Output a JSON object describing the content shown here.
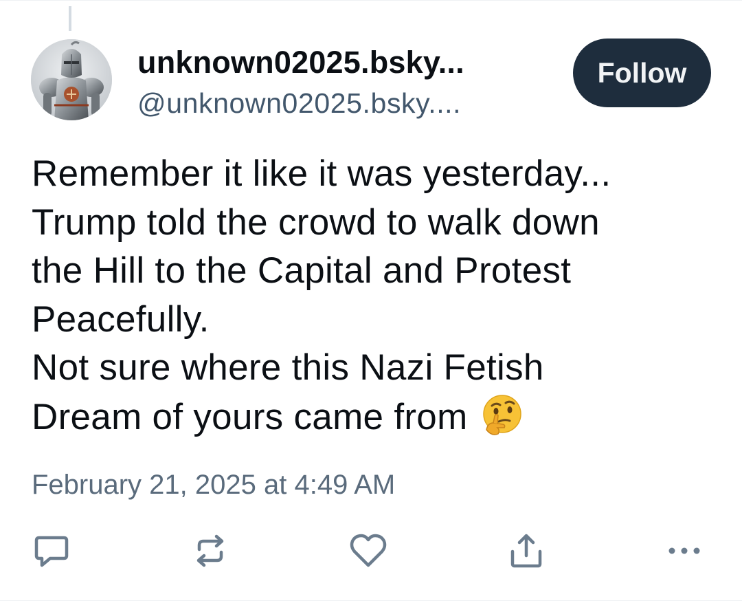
{
  "post": {
    "author": {
      "display_name": "unknown02025.bsky...",
      "handle": "@unknown02025.bsky....",
      "avatar": "knight-armor-avatar"
    },
    "follow_label": "Follow",
    "text_lines": [
      "Remember it like it was yesterday...",
      "Trump told the crowd to walk down",
      "the Hill to the Capital and Protest",
      "Peacefully.",
      "Not sure where this Nazi Fetish",
      "Dream of yours came from"
    ],
    "emoji": "thinking-face",
    "timestamp": "February 21, 2025 at 4:49 AM"
  },
  "actions": [
    "reply-icon",
    "repost-icon",
    "like-icon",
    "share-icon",
    "more-options-icon"
  ],
  "colors": {
    "follow_bg": "#1e2d3d",
    "icon": "#6b7c8d",
    "secondary_text": "#42576c"
  }
}
